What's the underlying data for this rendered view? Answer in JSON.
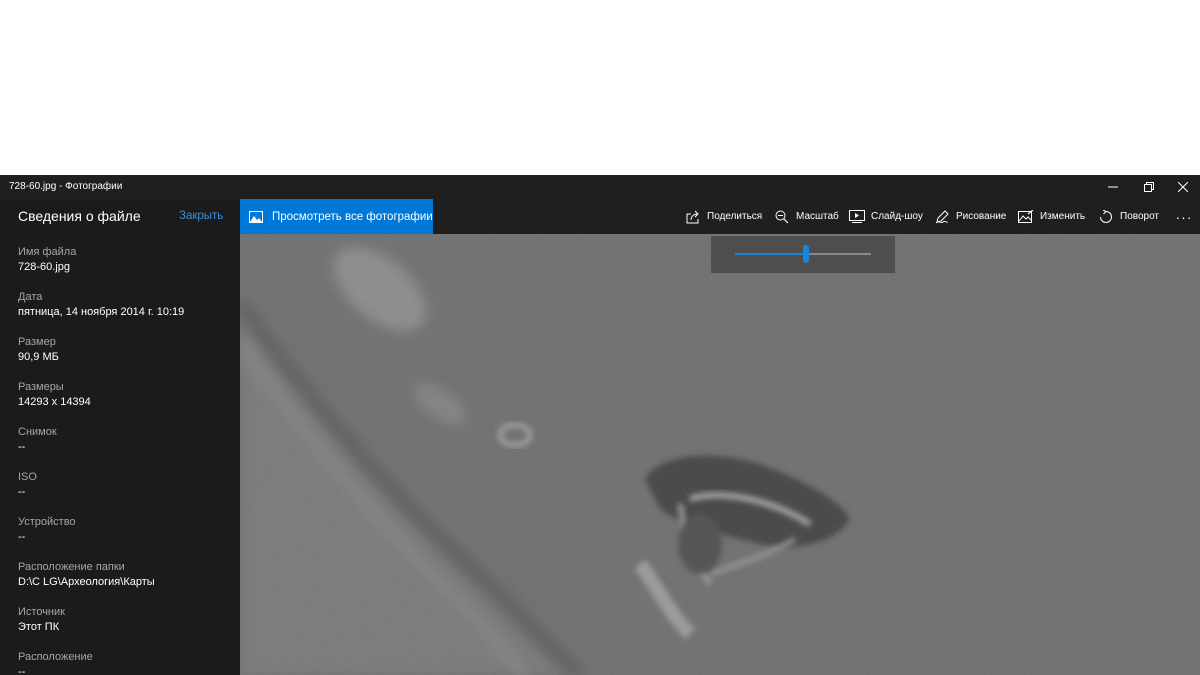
{
  "window": {
    "title": "728-60.jpg - Фотографии"
  },
  "sidebar": {
    "heading": "Сведения о файле",
    "close_label": "Закрыть",
    "props": [
      {
        "label": "Имя файла",
        "value": "728-60.jpg"
      },
      {
        "label": "Дата",
        "value": "пятница, 14 ноября 2014 г. 10:19"
      },
      {
        "label": "Размер",
        "value": "90,9 МБ"
      },
      {
        "label": "Размеры",
        "value": "14293 x 14394"
      },
      {
        "label": "Снимок",
        "value": "--"
      },
      {
        "label": "ISO",
        "value": "--"
      },
      {
        "label": "Устройство",
        "value": "--"
      },
      {
        "label": "Расположение папки",
        "value": "D:\\C LG\\Археология\\Карты"
      },
      {
        "label": "Источник",
        "value": "Этот ПК"
      },
      {
        "label": "Расположение",
        "value": "--"
      }
    ]
  },
  "toolbar": {
    "view_all_label": "Просмотреть все фотографии",
    "share_label": "Поделиться",
    "zoom_label": "Масштаб",
    "slideshow_label": "Слайд-шоу",
    "draw_label": "Рисование",
    "edit_label": "Изменить",
    "rotate_label": "Поворот",
    "more_label": "···"
  },
  "zoom": {
    "level": 0.52
  },
  "colors": {
    "accent": "#0078d7",
    "link": "#3b8fdb",
    "background": "#1f1f1f"
  }
}
